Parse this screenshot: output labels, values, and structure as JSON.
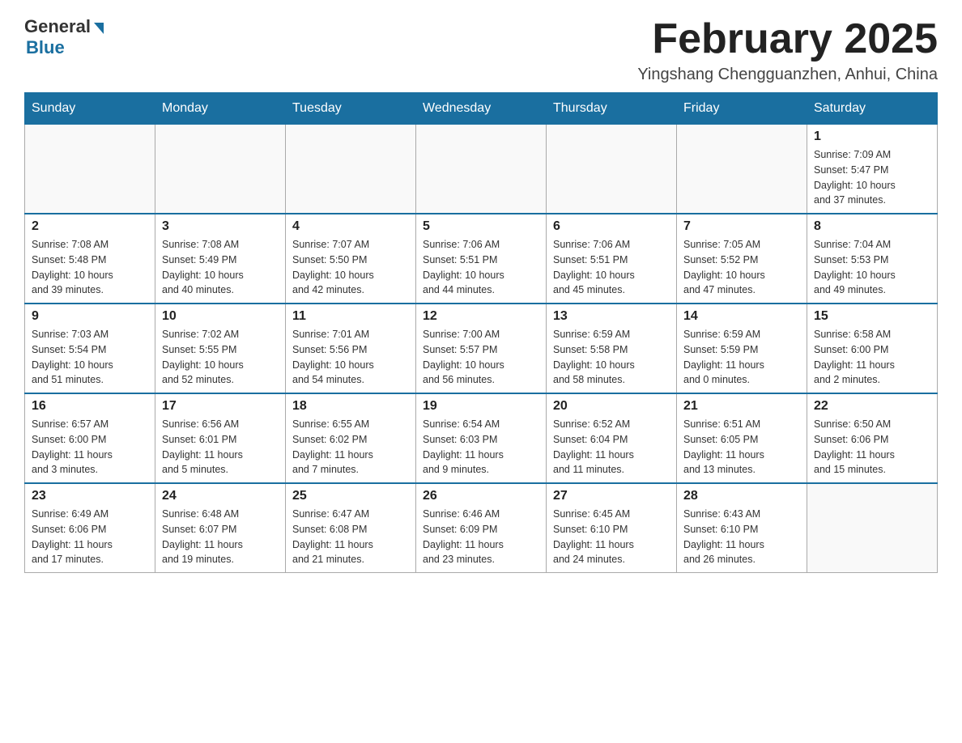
{
  "header": {
    "logo_general": "General",
    "logo_blue": "Blue",
    "month_title": "February 2025",
    "location": "Yingshang Chengguanzhen, Anhui, China"
  },
  "weekdays": [
    "Sunday",
    "Monday",
    "Tuesday",
    "Wednesday",
    "Thursday",
    "Friday",
    "Saturday"
  ],
  "weeks": [
    [
      {
        "day": "",
        "info": []
      },
      {
        "day": "",
        "info": []
      },
      {
        "day": "",
        "info": []
      },
      {
        "day": "",
        "info": []
      },
      {
        "day": "",
        "info": []
      },
      {
        "day": "",
        "info": []
      },
      {
        "day": "1",
        "info": [
          "Sunrise: 7:09 AM",
          "Sunset: 5:47 PM",
          "Daylight: 10 hours",
          "and 37 minutes."
        ]
      }
    ],
    [
      {
        "day": "2",
        "info": [
          "Sunrise: 7:08 AM",
          "Sunset: 5:48 PM",
          "Daylight: 10 hours",
          "and 39 minutes."
        ]
      },
      {
        "day": "3",
        "info": [
          "Sunrise: 7:08 AM",
          "Sunset: 5:49 PM",
          "Daylight: 10 hours",
          "and 40 minutes."
        ]
      },
      {
        "day": "4",
        "info": [
          "Sunrise: 7:07 AM",
          "Sunset: 5:50 PM",
          "Daylight: 10 hours",
          "and 42 minutes."
        ]
      },
      {
        "day": "5",
        "info": [
          "Sunrise: 7:06 AM",
          "Sunset: 5:51 PM",
          "Daylight: 10 hours",
          "and 44 minutes."
        ]
      },
      {
        "day": "6",
        "info": [
          "Sunrise: 7:06 AM",
          "Sunset: 5:51 PM",
          "Daylight: 10 hours",
          "and 45 minutes."
        ]
      },
      {
        "day": "7",
        "info": [
          "Sunrise: 7:05 AM",
          "Sunset: 5:52 PM",
          "Daylight: 10 hours",
          "and 47 minutes."
        ]
      },
      {
        "day": "8",
        "info": [
          "Sunrise: 7:04 AM",
          "Sunset: 5:53 PM",
          "Daylight: 10 hours",
          "and 49 minutes."
        ]
      }
    ],
    [
      {
        "day": "9",
        "info": [
          "Sunrise: 7:03 AM",
          "Sunset: 5:54 PM",
          "Daylight: 10 hours",
          "and 51 minutes."
        ]
      },
      {
        "day": "10",
        "info": [
          "Sunrise: 7:02 AM",
          "Sunset: 5:55 PM",
          "Daylight: 10 hours",
          "and 52 minutes."
        ]
      },
      {
        "day": "11",
        "info": [
          "Sunrise: 7:01 AM",
          "Sunset: 5:56 PM",
          "Daylight: 10 hours",
          "and 54 minutes."
        ]
      },
      {
        "day": "12",
        "info": [
          "Sunrise: 7:00 AM",
          "Sunset: 5:57 PM",
          "Daylight: 10 hours",
          "and 56 minutes."
        ]
      },
      {
        "day": "13",
        "info": [
          "Sunrise: 6:59 AM",
          "Sunset: 5:58 PM",
          "Daylight: 10 hours",
          "and 58 minutes."
        ]
      },
      {
        "day": "14",
        "info": [
          "Sunrise: 6:59 AM",
          "Sunset: 5:59 PM",
          "Daylight: 11 hours",
          "and 0 minutes."
        ]
      },
      {
        "day": "15",
        "info": [
          "Sunrise: 6:58 AM",
          "Sunset: 6:00 PM",
          "Daylight: 11 hours",
          "and 2 minutes."
        ]
      }
    ],
    [
      {
        "day": "16",
        "info": [
          "Sunrise: 6:57 AM",
          "Sunset: 6:00 PM",
          "Daylight: 11 hours",
          "and 3 minutes."
        ]
      },
      {
        "day": "17",
        "info": [
          "Sunrise: 6:56 AM",
          "Sunset: 6:01 PM",
          "Daylight: 11 hours",
          "and 5 minutes."
        ]
      },
      {
        "day": "18",
        "info": [
          "Sunrise: 6:55 AM",
          "Sunset: 6:02 PM",
          "Daylight: 11 hours",
          "and 7 minutes."
        ]
      },
      {
        "day": "19",
        "info": [
          "Sunrise: 6:54 AM",
          "Sunset: 6:03 PM",
          "Daylight: 11 hours",
          "and 9 minutes."
        ]
      },
      {
        "day": "20",
        "info": [
          "Sunrise: 6:52 AM",
          "Sunset: 6:04 PM",
          "Daylight: 11 hours",
          "and 11 minutes."
        ]
      },
      {
        "day": "21",
        "info": [
          "Sunrise: 6:51 AM",
          "Sunset: 6:05 PM",
          "Daylight: 11 hours",
          "and 13 minutes."
        ]
      },
      {
        "day": "22",
        "info": [
          "Sunrise: 6:50 AM",
          "Sunset: 6:06 PM",
          "Daylight: 11 hours",
          "and 15 minutes."
        ]
      }
    ],
    [
      {
        "day": "23",
        "info": [
          "Sunrise: 6:49 AM",
          "Sunset: 6:06 PM",
          "Daylight: 11 hours",
          "and 17 minutes."
        ]
      },
      {
        "day": "24",
        "info": [
          "Sunrise: 6:48 AM",
          "Sunset: 6:07 PM",
          "Daylight: 11 hours",
          "and 19 minutes."
        ]
      },
      {
        "day": "25",
        "info": [
          "Sunrise: 6:47 AM",
          "Sunset: 6:08 PM",
          "Daylight: 11 hours",
          "and 21 minutes."
        ]
      },
      {
        "day": "26",
        "info": [
          "Sunrise: 6:46 AM",
          "Sunset: 6:09 PM",
          "Daylight: 11 hours",
          "and 23 minutes."
        ]
      },
      {
        "day": "27",
        "info": [
          "Sunrise: 6:45 AM",
          "Sunset: 6:10 PM",
          "Daylight: 11 hours",
          "and 24 minutes."
        ]
      },
      {
        "day": "28",
        "info": [
          "Sunrise: 6:43 AM",
          "Sunset: 6:10 PM",
          "Daylight: 11 hours",
          "and 26 minutes."
        ]
      },
      {
        "day": "",
        "info": []
      }
    ]
  ]
}
